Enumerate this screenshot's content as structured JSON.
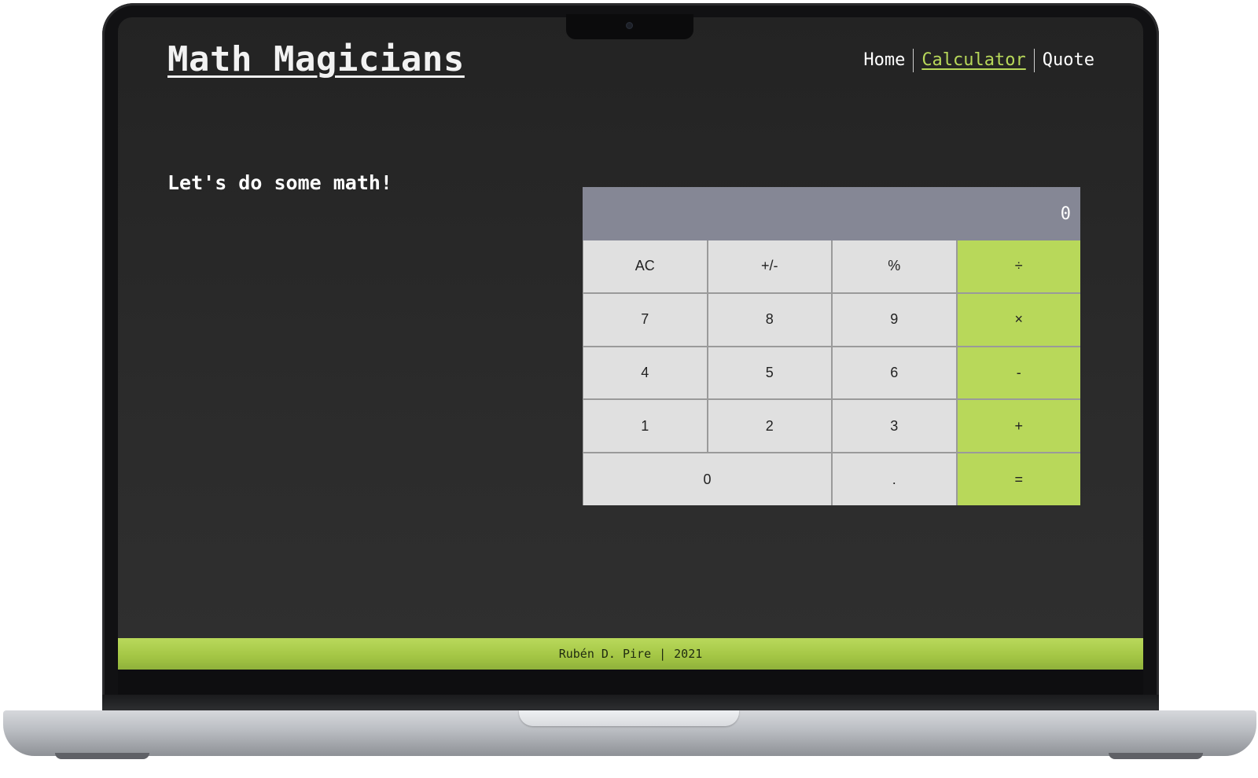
{
  "brand": {
    "title": "Math Magicians"
  },
  "nav": {
    "items": [
      {
        "label": "Home",
        "active": false
      },
      {
        "label": "Calculator",
        "active": true
      },
      {
        "label": "Quote",
        "active": false
      }
    ]
  },
  "main": {
    "intro": "Let's do some math!"
  },
  "calculator": {
    "display": "0",
    "keys": [
      {
        "label": "AC",
        "type": "func"
      },
      {
        "label": "+/-",
        "type": "func"
      },
      {
        "label": "%",
        "type": "func"
      },
      {
        "label": "÷",
        "type": "op"
      },
      {
        "label": "7",
        "type": "digit"
      },
      {
        "label": "8",
        "type": "digit"
      },
      {
        "label": "9",
        "type": "digit"
      },
      {
        "label": "×",
        "type": "op"
      },
      {
        "label": "4",
        "type": "digit"
      },
      {
        "label": "5",
        "type": "digit"
      },
      {
        "label": "6",
        "type": "digit"
      },
      {
        "label": "-",
        "type": "op"
      },
      {
        "label": "1",
        "type": "digit"
      },
      {
        "label": "2",
        "type": "digit"
      },
      {
        "label": "3",
        "type": "digit"
      },
      {
        "label": "+",
        "type": "op"
      },
      {
        "label": "0",
        "type": "digit",
        "wide": true
      },
      {
        "label": ".",
        "type": "digit"
      },
      {
        "label": "=",
        "type": "op"
      }
    ]
  },
  "footer": {
    "author": "Rubén D. Pire",
    "separator": "|",
    "year": "2021"
  },
  "colors": {
    "accent": "#b8d85a",
    "display_bg": "#858795",
    "key_bg": "#e0e0e0",
    "page_bg": "#2a2a2a"
  }
}
